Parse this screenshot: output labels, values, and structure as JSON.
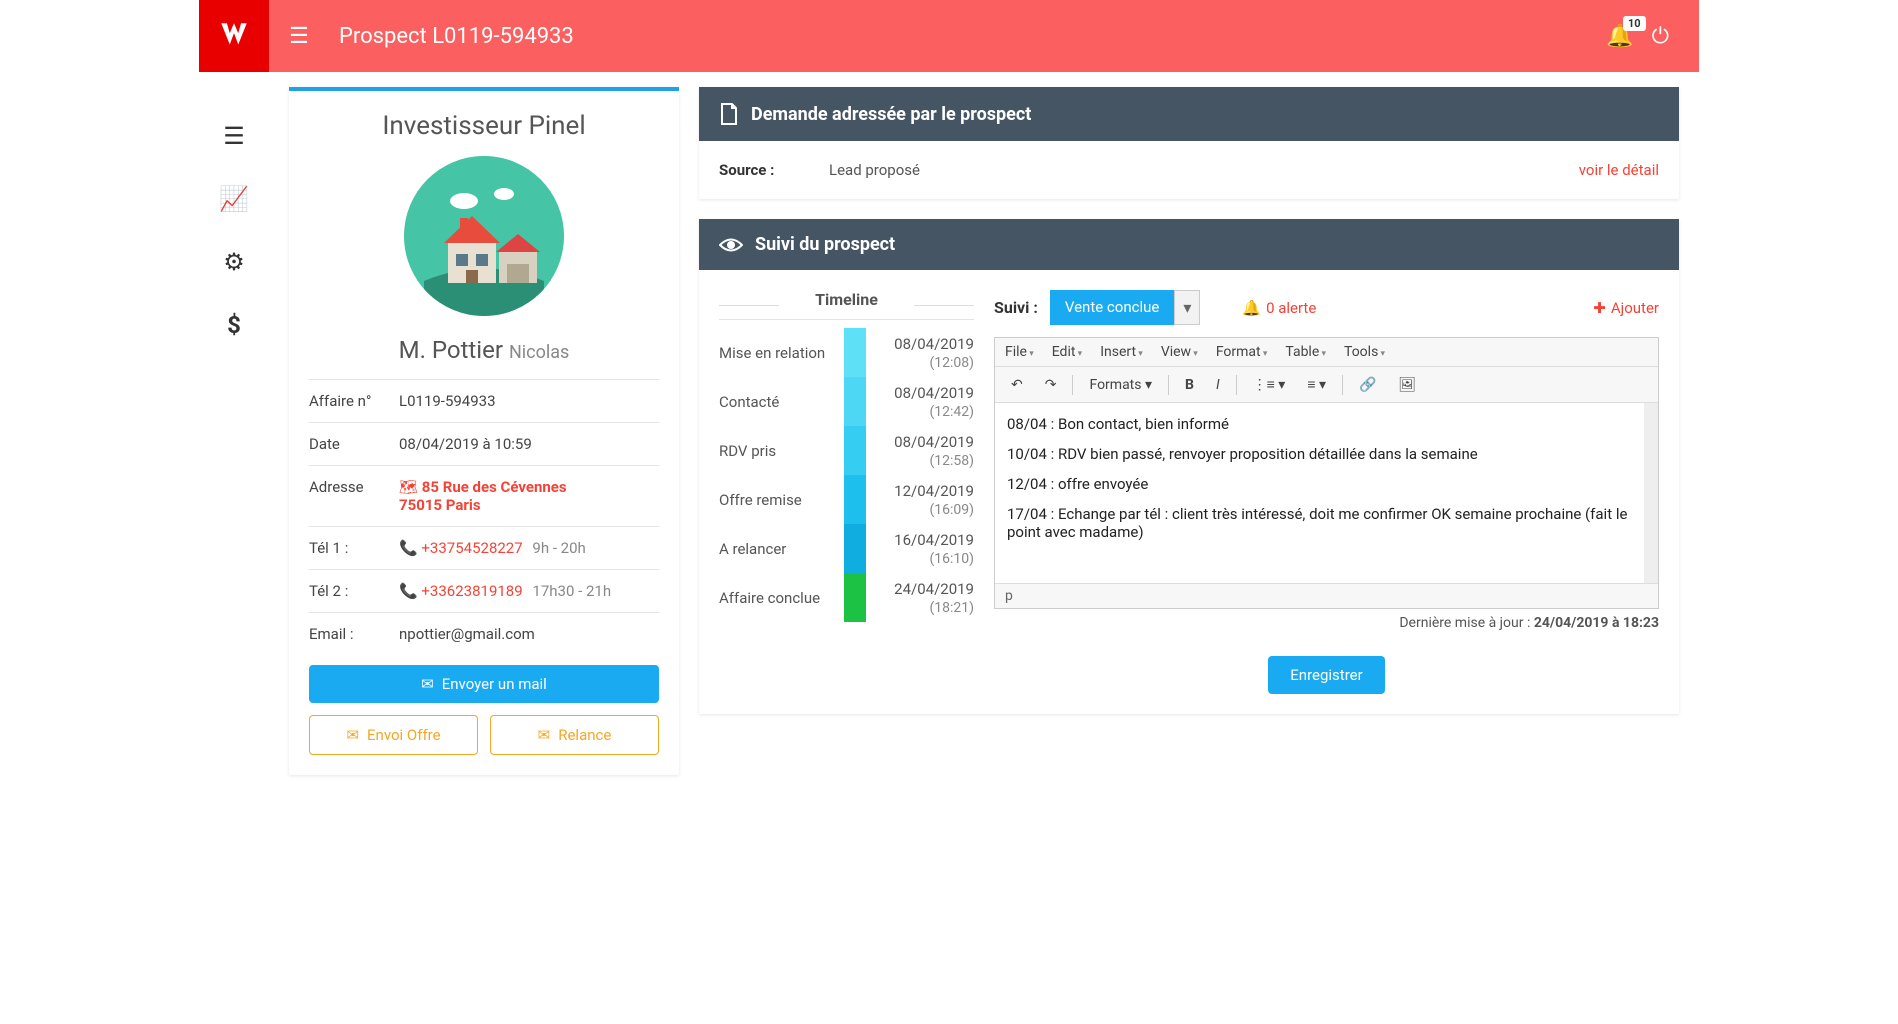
{
  "header": {
    "title": "Prospect L0119-594933",
    "notif_count": "10"
  },
  "prospect": {
    "title": "Investisseur Pinel",
    "name_last": "M. Pottier",
    "name_first": "Nicolas",
    "affaire_label": "Affaire n°",
    "affaire_value": "L0119-594933",
    "date_label": "Date",
    "date_value": "08/04/2019 à 10:59",
    "adresse_label": "Adresse",
    "adresse_line1": "85 Rue des Cévennes",
    "adresse_line2": "75015 Paris",
    "tel1_label": "Tél 1 :",
    "tel1_value": "+33754528227",
    "tel1_hours": "9h - 20h",
    "tel2_label": "Tél 2 :",
    "tel2_value": "+33623819189",
    "tel2_hours": "17h30 - 21h",
    "email_label": "Email :",
    "email_value": "npottier@gmail.com",
    "btn_mail": "Envoyer un mail",
    "btn_offre": "Envoi Offre",
    "btn_relance": "Relance"
  },
  "demande": {
    "header": "Demande adressée par le prospect",
    "source_label": "Source :",
    "source_value": "Lead proposé",
    "voir_detail": "voir le détail"
  },
  "suivi": {
    "header": "Suivi du prospect",
    "timeline_title": "Timeline",
    "timeline": [
      {
        "label": "Mise en relation",
        "date": "08/04/2019",
        "time": "(12:08)",
        "color": "#5ee0f6"
      },
      {
        "label": "Contacté",
        "date": "08/04/2019",
        "time": "(12:42)",
        "color": "#4dd7f4"
      },
      {
        "label": "RDV pris",
        "date": "08/04/2019",
        "time": "(12:58)",
        "color": "#35cdf1"
      },
      {
        "label": "Offre remise",
        "date": "12/04/2019",
        "time": "(16:09)",
        "color": "#1dc0ec"
      },
      {
        "label": "A relancer",
        "date": "16/04/2019",
        "time": "(16:10)",
        "color": "#10aee0"
      },
      {
        "label": "Affaire conclue",
        "date": "24/04/2019",
        "time": "(18:21)",
        "color": "#1cc244"
      }
    ],
    "suivi_label": "Suivi :",
    "select_value": "Vente conclue",
    "alert_text": "0 alerte",
    "ajouter_text": "Ajouter",
    "editor_menubar": [
      "File",
      "Edit",
      "Insert",
      "View",
      "Format",
      "Table",
      "Tools"
    ],
    "formats_label": "Formats",
    "editor_lines": [
      "08/04 : Bon contact, bien informé",
      "10/04 : RDV bien passé, renvoyer proposition détaillée dans la semaine",
      "12/04 : offre envoyée",
      "17/04 : Echange par tél : client très intéressé, doit me confirmer OK semaine prochaine (fait le point avec madame)"
    ],
    "status_path": "p",
    "last_update_label": "Dernière mise à jour : ",
    "last_update_value": "24/04/2019 à 18:23",
    "btn_enregistrer": "Enregistrer"
  }
}
